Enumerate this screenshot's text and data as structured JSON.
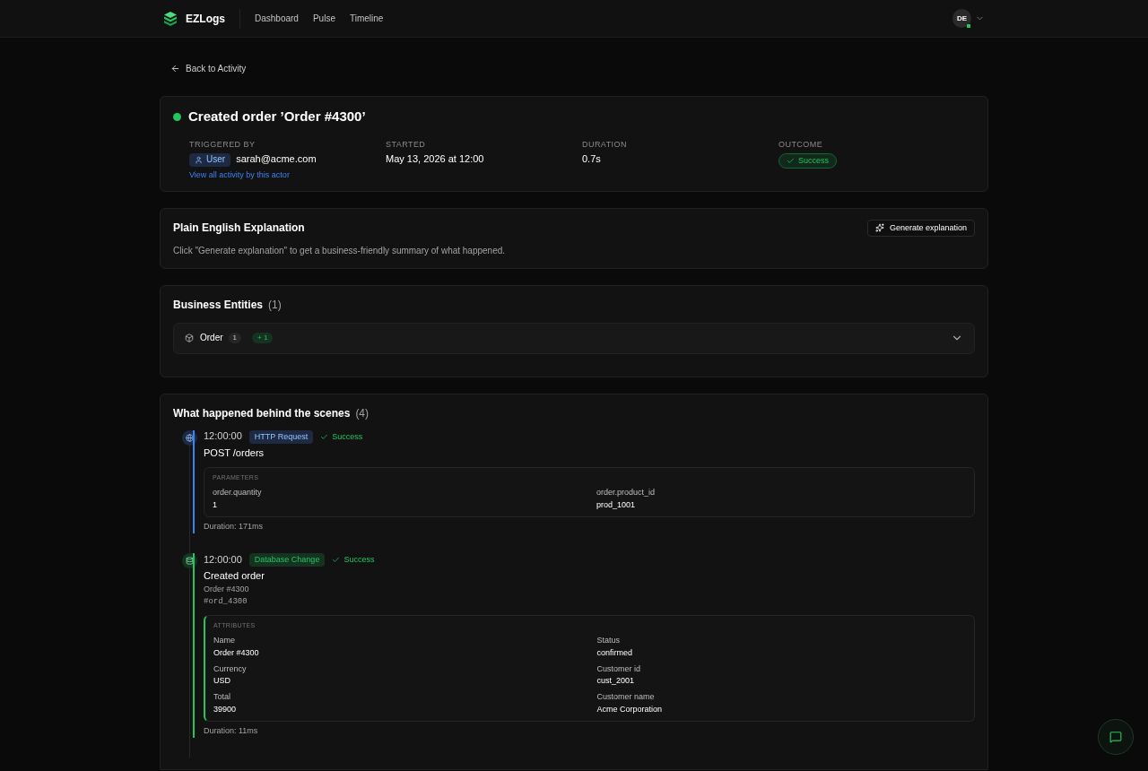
{
  "header": {
    "brand": "EZLogs",
    "nav": [
      {
        "label": "Dashboard",
        "selected": false
      },
      {
        "label": "Pulse",
        "selected": false
      },
      {
        "label": "Timeline",
        "selected": false
      }
    ],
    "avatar": {
      "initials": "DE",
      "online": true
    }
  },
  "back_link": "Back to Activity",
  "activity": {
    "success": true,
    "title": "Created order ’Order #4300’",
    "meta": [
      {
        "kind": "actor",
        "label": "TRIGGERED BY",
        "badge": "User",
        "value": "sarah@acme.com",
        "link": "View all activity by this actor"
      },
      {
        "kind": "text",
        "label": "STARTED",
        "value": "May 13, 2026 at 12:00"
      },
      {
        "kind": "text",
        "label": "DURATION",
        "value": "0.7s"
      },
      {
        "kind": "outcome",
        "label": "OUTCOME",
        "value": "Success"
      }
    ]
  },
  "explanation": {
    "title": "Plain English Explanation",
    "button": "Generate explanation",
    "text": "Click \"Generate explanation\" to get a business-friendly summary of what happened."
  },
  "entities": {
    "title": "Business Entities",
    "count": "(1)",
    "items": [
      {
        "name": "Order",
        "count": "1",
        "change": "+ 1",
        "expanded": false
      }
    ]
  },
  "events": {
    "title": "What happened behind the scenes",
    "count": "(4)",
    "items": [
      {
        "kind": "http",
        "time": "12:00:00",
        "type": "HTTP Request",
        "status": "Success",
        "title": "POST /orders",
        "section": "PARAMETERS",
        "fields": [
          {
            "label": "order.quantity",
            "value": "1"
          },
          {
            "label": "order.product_id",
            "value": "prod_1001"
          }
        ],
        "duration": "Duration: 171ms"
      },
      {
        "kind": "db",
        "time": "12:00:00",
        "type": "Database Change",
        "status": "Success",
        "title": "Created order",
        "subtitle": "Order #4300",
        "code": "#ord_4300",
        "section": "ATTRIBUTES",
        "fields": [
          {
            "label": "Name",
            "value": "Order #4300"
          },
          {
            "label": "Status",
            "value": "confirmed"
          },
          {
            "label": "Currency",
            "value": "USD"
          },
          {
            "label": "Customer id",
            "value": "cust_2001"
          },
          {
            "label": "Total",
            "value": "39900"
          },
          {
            "label": "Customer name",
            "value": "Acme Corporation"
          }
        ],
        "duration": "Duration: 11ms"
      }
    ]
  }
}
